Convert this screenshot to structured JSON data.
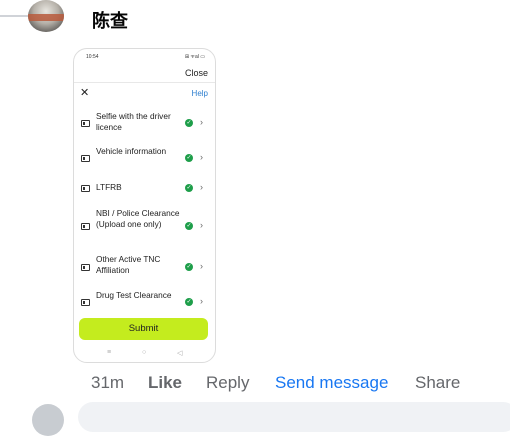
{
  "comment": {
    "author": "陈查",
    "time_ago": "31m",
    "actions": {
      "like": "Like",
      "reply": "Reply",
      "send_message": "Send message",
      "share": "Share"
    }
  },
  "screenshot": {
    "status_time": "10:54",
    "status_icons": "⊞ ᯤal ▭",
    "close_label": "Close",
    "help_label": "Help",
    "x_label": "✕",
    "items": [
      {
        "label": "Selfie with the driver licence",
        "icon": "document-icon",
        "status": "check-icon"
      },
      {
        "label": "Vehicle information",
        "icon": "document-icon",
        "status": "check-icon"
      },
      {
        "label": "LTFRB",
        "icon": "document-icon",
        "status": "check-icon"
      },
      {
        "label": "NBI / Police Clearance (Upload one only)",
        "icon": "document-icon",
        "status": "check-icon"
      },
      {
        "label": "Other Active TNC Affiliation",
        "icon": "document-icon",
        "status": "check-icon"
      },
      {
        "label": "Drug Test Clearance",
        "icon": "document-icon",
        "status": "check-icon"
      }
    ],
    "submit_label": "Submit",
    "nav": {
      "menu": "≡",
      "home": "○",
      "back": "◁"
    }
  },
  "colors": {
    "link_blue": "#1877f2",
    "muted": "#65676b",
    "submit_green": "#c4ec1e",
    "check_green": "#1e9e4a",
    "help_blue": "#2f7fcf"
  }
}
